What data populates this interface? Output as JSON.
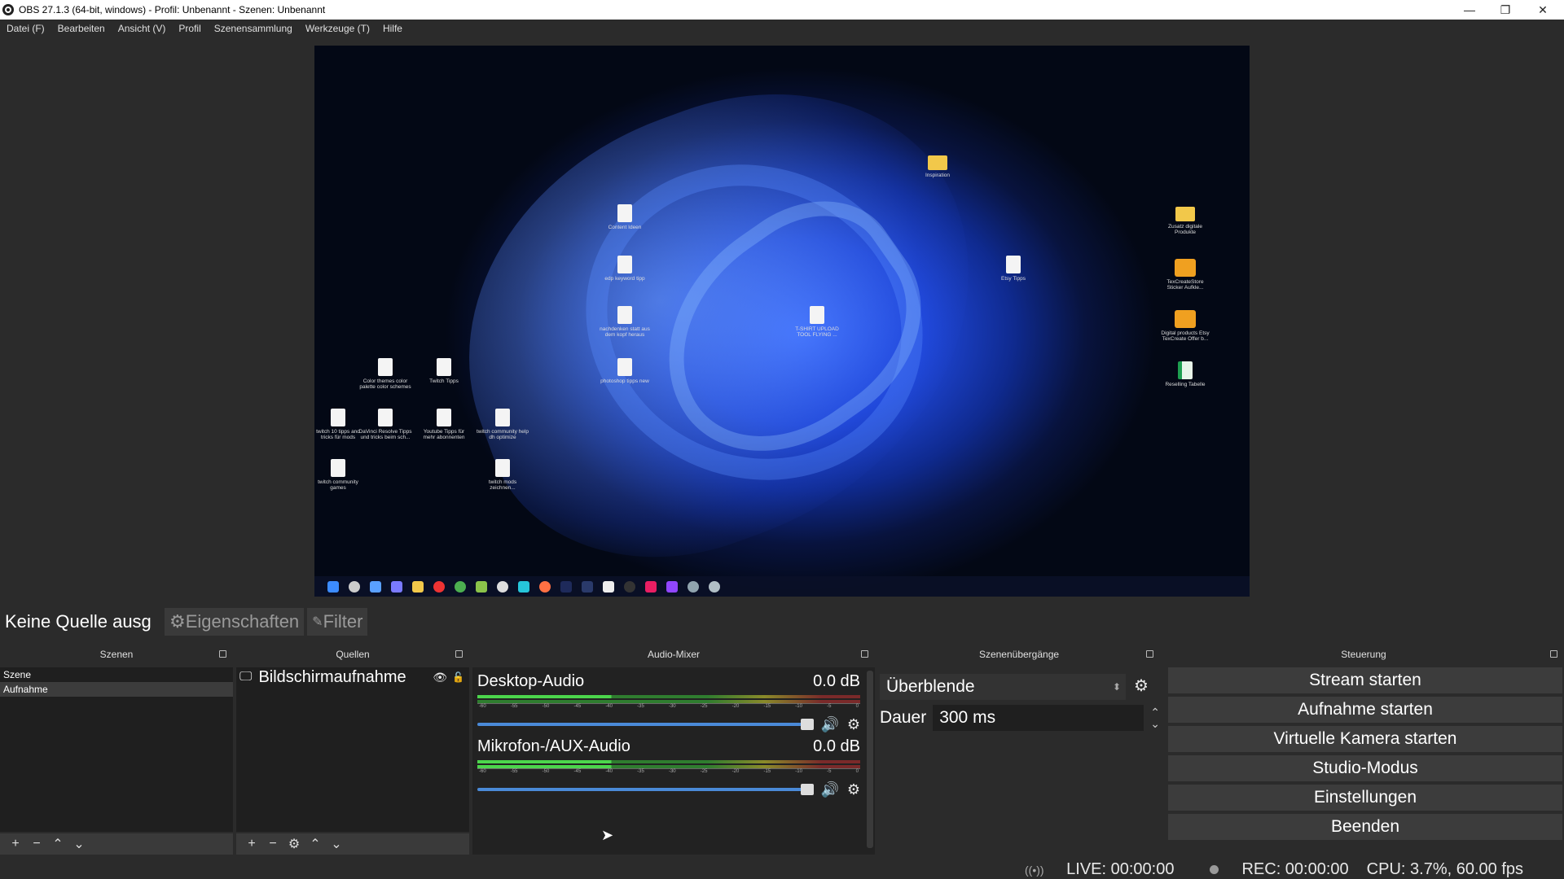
{
  "window": {
    "title": "OBS 27.1.3 (64-bit, windows) - Profil: Unbenannt - Szenen: Unbenannt",
    "minimize": "—",
    "restore": "❐",
    "close": "✕"
  },
  "menu": [
    "Datei (F)",
    "Bearbeiten",
    "Ansicht (V)",
    "Profil",
    "Szenensammlung",
    "Werkzeuge (T)",
    "Hilfe"
  ],
  "preview": {
    "desktop_icons": [
      {
        "label": "Inspiration",
        "kind": "folder"
      },
      {
        "label": "Zusatz digitale Produkte",
        "kind": "folder"
      },
      {
        "label": "TexCreateStore Sticker Aufkle...",
        "kind": "app"
      },
      {
        "label": "Digital products Etsy TexCreate Offer b...",
        "kind": "app"
      },
      {
        "label": "Reselling Tabelle",
        "kind": "sheet"
      },
      {
        "label": "Content Ideen",
        "kind": "doc"
      },
      {
        "label": "Etsy Tipps",
        "kind": "doc"
      },
      {
        "label": "edp keyword tipp",
        "kind": "doc"
      },
      {
        "label": "nachdenken statt aus dem kopf heraus",
        "kind": "doc"
      },
      {
        "label": "T-SHIRT UPLOAD TOOL FLYING ...",
        "kind": "doc"
      },
      {
        "label": "photoshop tipps new",
        "kind": "doc"
      },
      {
        "label": "Color themes color palette color schemes",
        "kind": "doc"
      },
      {
        "label": "Twitch Tipps",
        "kind": "doc"
      },
      {
        "label": "twitch 10 tipps and tricks für mods",
        "kind": "doc"
      },
      {
        "label": "DaVinci Resolve Tipps und tricks beim sch...",
        "kind": "doc"
      },
      {
        "label": "Youtube Tipps für mehr abonnenten",
        "kind": "doc"
      },
      {
        "label": "twitch community help dh optimize",
        "kind": "doc"
      },
      {
        "label": "twitch community games",
        "kind": "doc"
      },
      {
        "label": "twitch mods zeichnen...",
        "kind": "doc"
      }
    ]
  },
  "source_bar": {
    "no_source": "Keine Quelle ausg",
    "properties": "Eigenschaften",
    "filters": "Filter"
  },
  "docks": {
    "scenes": {
      "title": "Szenen",
      "items": [
        "Szene",
        "Aufnahme"
      ],
      "selected": "Aufnahme"
    },
    "sources": {
      "title": "Quellen",
      "items": [
        {
          "name": "Bildschirmaufnahme",
          "visible": true,
          "locked": false
        }
      ]
    },
    "mixer": {
      "title": "Audio-Mixer",
      "ticks": [
        "-60",
        "-55",
        "-50",
        "-45",
        "-40",
        "-35",
        "-30",
        "-25",
        "-20",
        "-15",
        "-10",
        "-5",
        "0"
      ],
      "channels": [
        {
          "name": "Desktop-Audio",
          "level": "0.0 dB",
          "volume_fraction": 1.0
        },
        {
          "name": "Mikrofon-/AUX-Audio",
          "level": "0.0 dB",
          "volume_fraction": 1.0
        }
      ]
    },
    "transitions": {
      "title": "Szenenübergänge",
      "selected": "Überblende",
      "duration_label": "Dauer",
      "duration_value": "300 ms"
    },
    "controls": {
      "title": "Steuerung",
      "buttons": [
        "Stream starten",
        "Aufnahme starten",
        "Virtuelle Kamera starten",
        "Studio-Modus",
        "Einstellungen",
        "Beenden"
      ]
    }
  },
  "status": {
    "live": "LIVE: 00:00:00",
    "rec": "REC: 00:00:00",
    "cpu": "CPU: 3.7%, 60.00 fps"
  }
}
